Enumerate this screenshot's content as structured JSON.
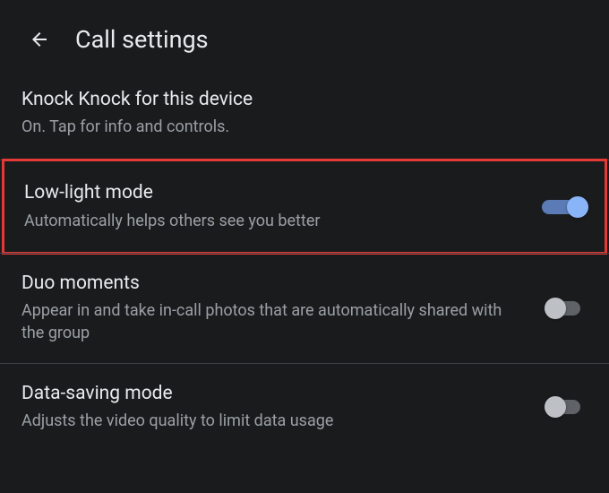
{
  "header": {
    "title": "Call settings"
  },
  "settings": {
    "knockKnock": {
      "title": "Knock Knock for this device",
      "subtitle": "On. Tap for info and controls."
    },
    "lowLight": {
      "title": "Low-light mode",
      "subtitle": "Automatically helps others see you better",
      "enabled": true
    },
    "duoMoments": {
      "title": "Duo moments",
      "subtitle": "Appear in and take in-call photos that are automatically shared with the group",
      "enabled": false
    },
    "dataSaving": {
      "title": "Data-saving mode",
      "subtitle": "Adjusts the video quality to limit data usage",
      "enabled": false
    }
  }
}
